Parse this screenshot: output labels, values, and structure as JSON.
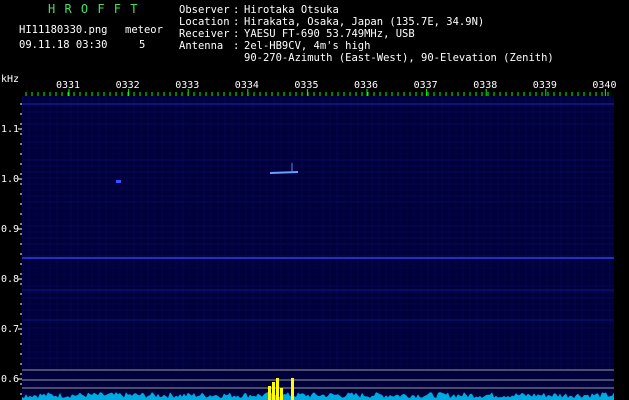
{
  "header": {
    "app_title": "H R O F F T",
    "filename": "HI11180330.png",
    "datetime": "09.11.18 03:30",
    "mode_label": "meteor",
    "mode_value": "5",
    "info": [
      {
        "key": "Observer",
        "value": "Hirotaka Otsuka"
      },
      {
        "key": "Location",
        "value": "Hirakata, Osaka, Japan (135.7E, 34.9N)"
      },
      {
        "key": "Receiver",
        "value": "YAESU FT-690 53.749MHz, USB"
      },
      {
        "key": "Antenna",
        "value": "2el-HB9CV, 4m's high"
      }
    ],
    "antenna_line2": "90-270-Azimuth (East-West), 90-Elevation (Zenith)"
  },
  "axes": {
    "y_unit": "kHz",
    "y_ticks": [
      "1.1",
      "1.0",
      "0.9",
      "0.8",
      "0.7",
      "0.6"
    ],
    "x_ticks": [
      "0331",
      "0332",
      "0333",
      "0334",
      "0335",
      "0336",
      "0337",
      "0338",
      "0339",
      "0340"
    ]
  },
  "colors": {
    "background": "#000000",
    "plot": "#00003a",
    "text": "#ffffff",
    "title": "#44e060",
    "signal": "#3040ff",
    "tick": "#00ff00",
    "baseline": "#9a9a9a",
    "spectrum": "#00c8ff",
    "peak": "#ffff00"
  }
}
